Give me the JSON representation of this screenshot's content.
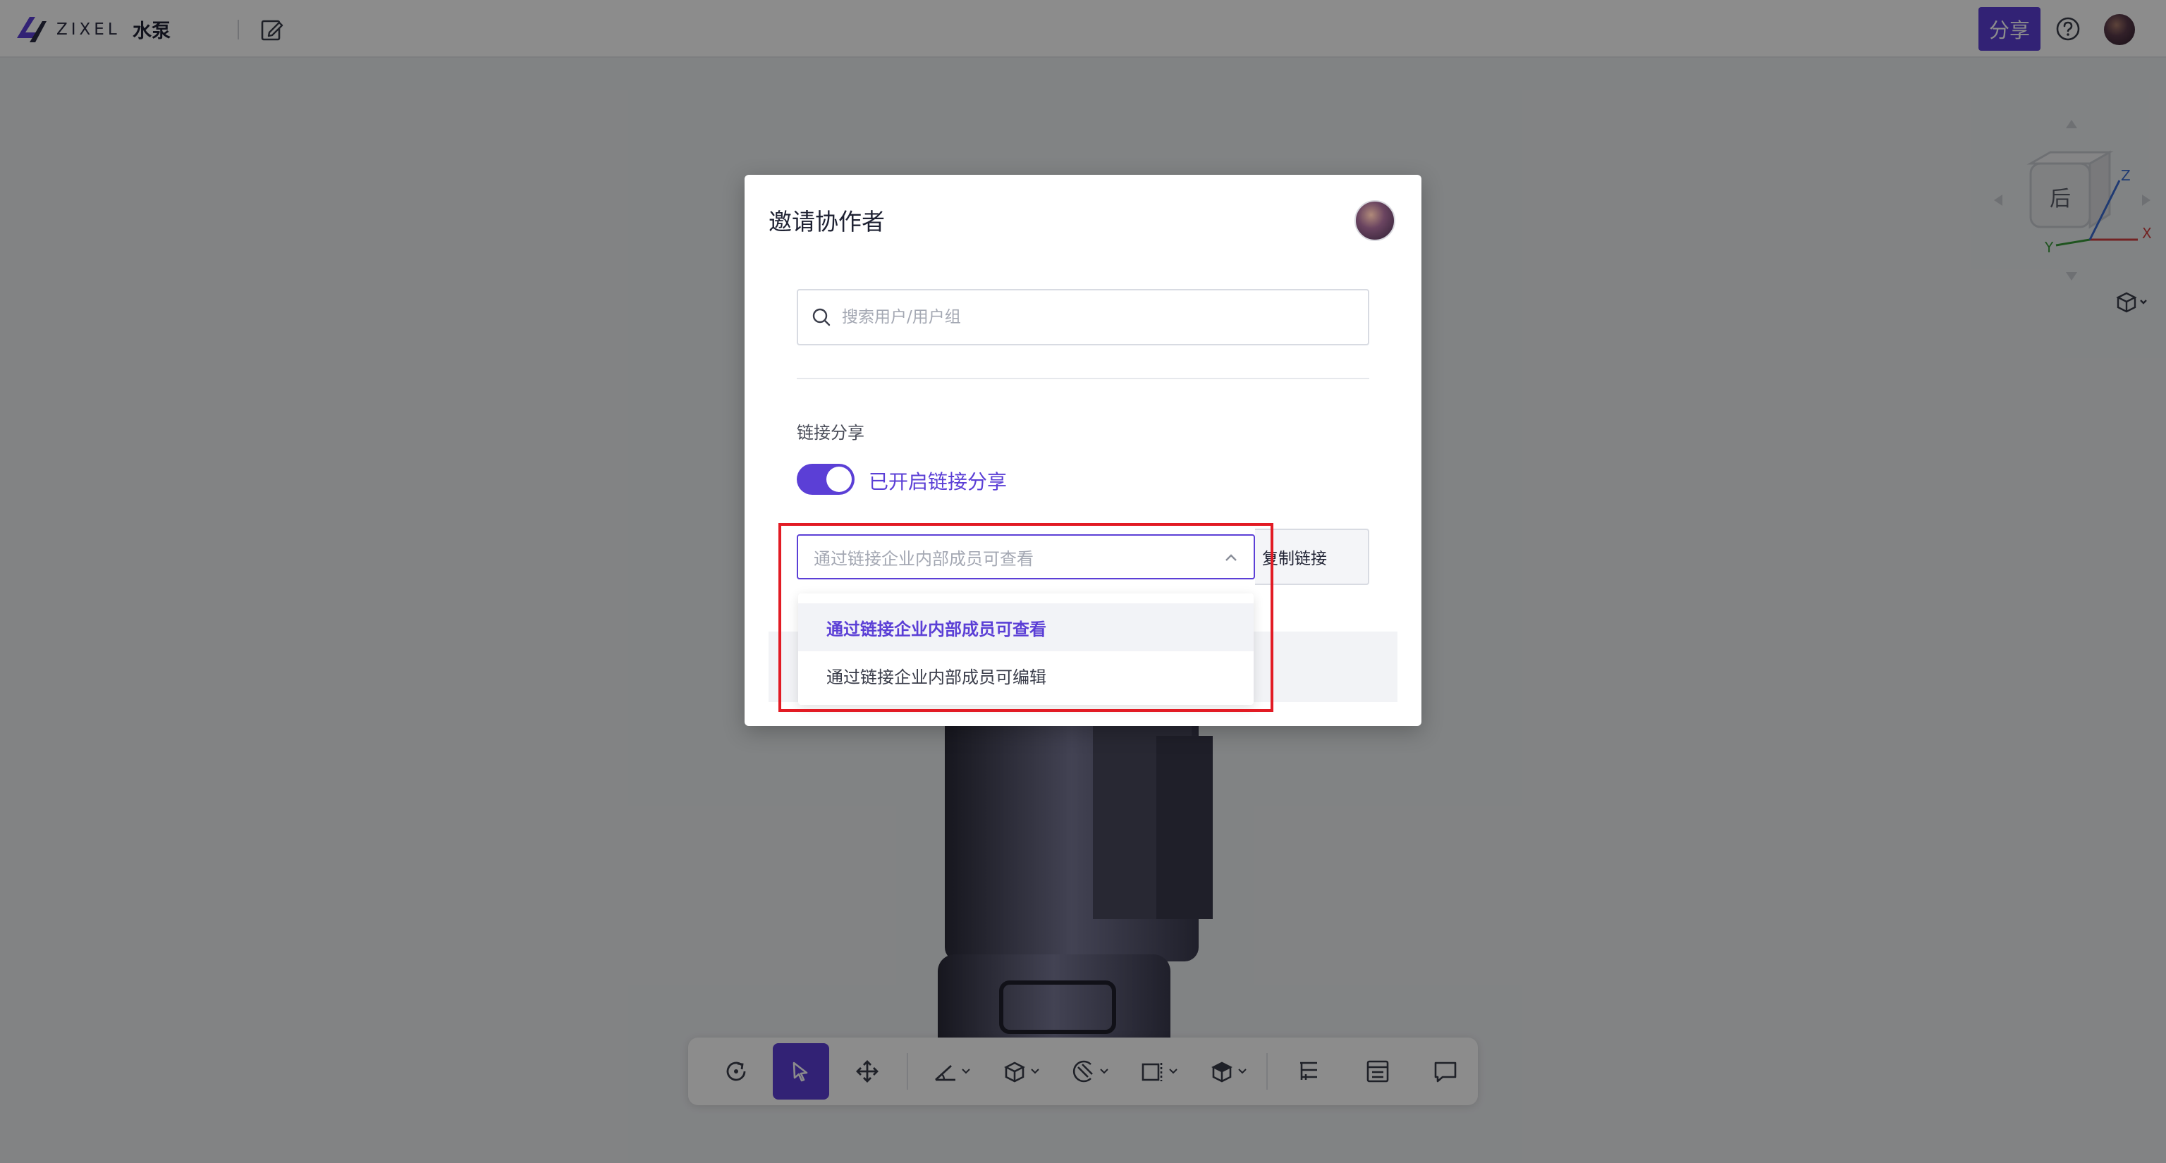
{
  "app": {
    "logo_text": "ZIXEL",
    "doc_title": "水泵",
    "share_label": "分享"
  },
  "viewcube": {
    "face_label": "后",
    "axis_x": "X",
    "axis_y": "Y",
    "axis_z": "Z"
  },
  "dialog": {
    "title": "邀请协作者",
    "search_placeholder": "搜索用户/用户组",
    "section_label": "链接分享",
    "toggle_label": "已开启链接分享",
    "toggle_on": true,
    "select_placeholder": "通过链接企业内部成员可查看",
    "copy_label": "复制链接",
    "options": [
      {
        "label": "通过链接企业内部成员可查看",
        "selected": true
      },
      {
        "label": "通过链接企业内部成员可编辑",
        "selected": false
      }
    ]
  },
  "colors": {
    "accent": "#5b3fd6",
    "highlight": "#e21b24"
  },
  "toolbar_icons": [
    "rotate-icon",
    "select-icon",
    "move-icon",
    "measure-icon",
    "explode-icon",
    "section-icon",
    "view-icon",
    "render-icon",
    "tree-icon",
    "properties-icon",
    "comment-icon"
  ]
}
